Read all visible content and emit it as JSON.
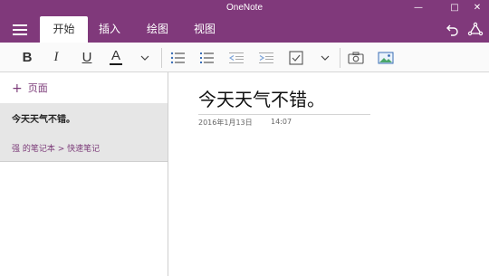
{
  "app": {
    "title": "OneNote"
  },
  "window_controls": {
    "minimize": "—",
    "maximize": "□",
    "close": "✕"
  },
  "tabs": [
    {
      "label": "开始",
      "active": true
    },
    {
      "label": "插入",
      "active": false
    },
    {
      "label": "绘图",
      "active": false
    },
    {
      "label": "视图",
      "active": false
    }
  ],
  "ribbon_icons": [
    "undo-icon",
    "share-icon"
  ],
  "toolbar": {
    "bold": "B",
    "italic": "I",
    "underline": "U",
    "font_color": "A",
    "font_color_swatch": "#1a1a1a",
    "icons": [
      "chevron-down-icon",
      "bullet-list-icon",
      "numbered-list-icon",
      "outdent-icon",
      "indent-icon",
      "checkbox-icon",
      "chevron-down-icon",
      "camera-icon",
      "image-icon"
    ]
  },
  "sidebar": {
    "add_page_label": "页面",
    "pages": [
      {
        "title": "今天天气不错。",
        "path": "强 的笔记本 > 快速笔记",
        "selected": true
      }
    ]
  },
  "note": {
    "title": "今天天气不错。",
    "date": "2016年1月13日",
    "time": "14:07"
  },
  "colors": {
    "accent": "#80397b",
    "link": "#7b3a78",
    "selected_page": "#e6e6e6"
  }
}
